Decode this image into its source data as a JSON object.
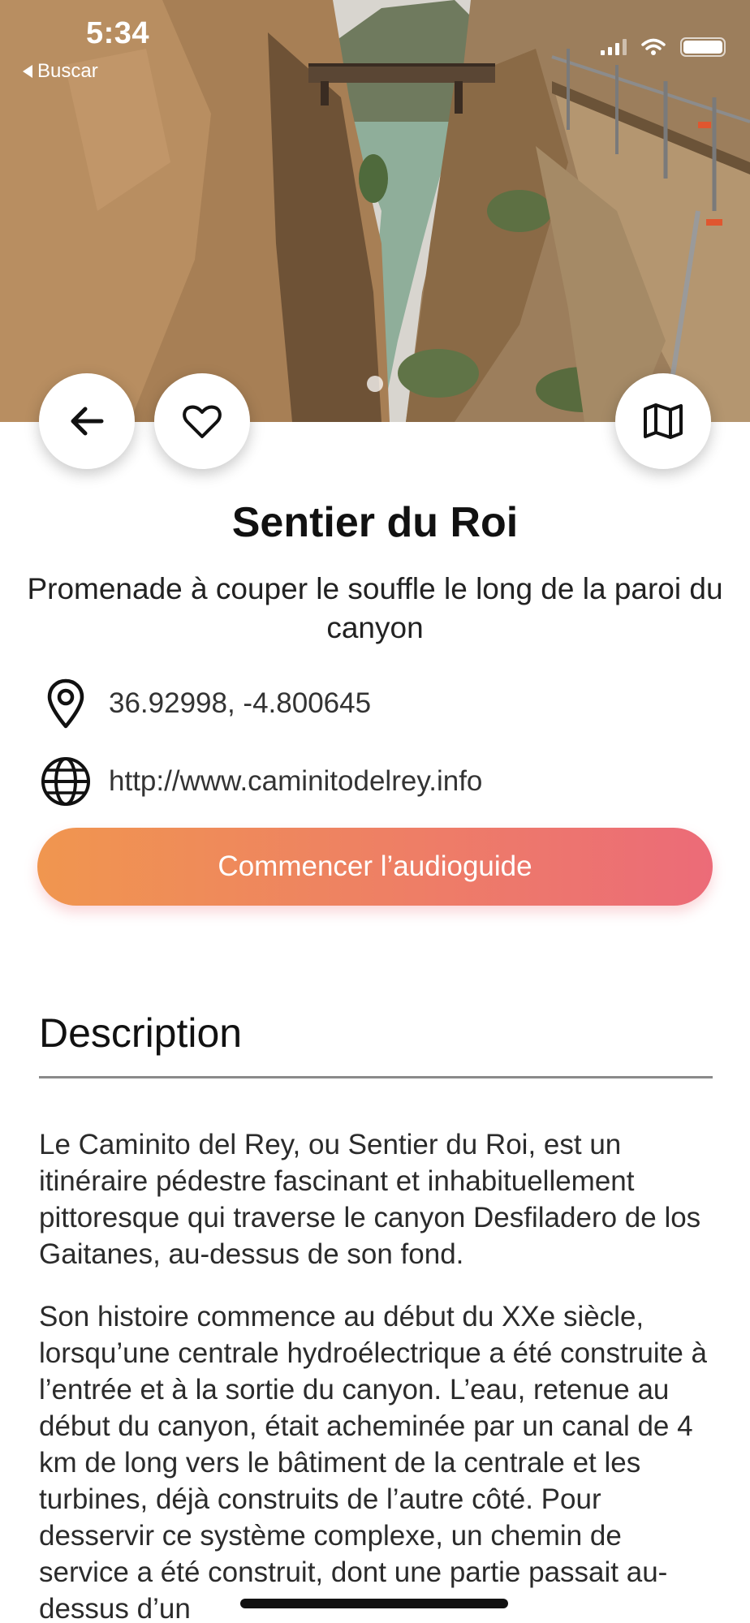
{
  "status_bar": {
    "time": "5:34",
    "back_app_label": "Buscar",
    "icons": [
      "signal-icon",
      "wifi-icon",
      "battery-icon"
    ]
  },
  "hero": {
    "image": "canyon-walkway-photo",
    "page_indicator": {
      "current": 1,
      "total": 1
    }
  },
  "actions": {
    "back_icon": "arrow-left-icon",
    "favorite_icon": "heart-icon",
    "map_icon": "map-icon"
  },
  "place": {
    "title": "Sentier du Roi",
    "subtitle": "Promenade à couper le souffle le long de la paroi du canyon",
    "coordinates": "36.92998, -4.800645",
    "website": "http://www.caminitodelrey.info"
  },
  "cta": {
    "label": "Commencer l’audioguide",
    "gradient_start": "#f0964f",
    "gradient_end": "#ec6b78"
  },
  "description": {
    "heading": "Description",
    "paragraphs": [
      "Le Caminito del Rey, ou Sentier du Roi, est un itinéraire pédestre fascinant et inhabituellement pittoresque qui traverse le canyon Desfiladero de los Gaitanes, au-dessus de son fond.",
      "Son histoire commence au début du XXe siècle, lorsqu’une centrale hydroélectrique a été construite à l’entrée et à la sortie du canyon. L’eau, retenue au début du canyon, était acheminée par un canal de 4 km de long vers le bâtiment de la centrale et les turbines, déjà construits de l’autre côté. Pour desservir ce système complexe, un chemin de service a été construit, dont une partie passait au-dessus d’un"
    ]
  }
}
